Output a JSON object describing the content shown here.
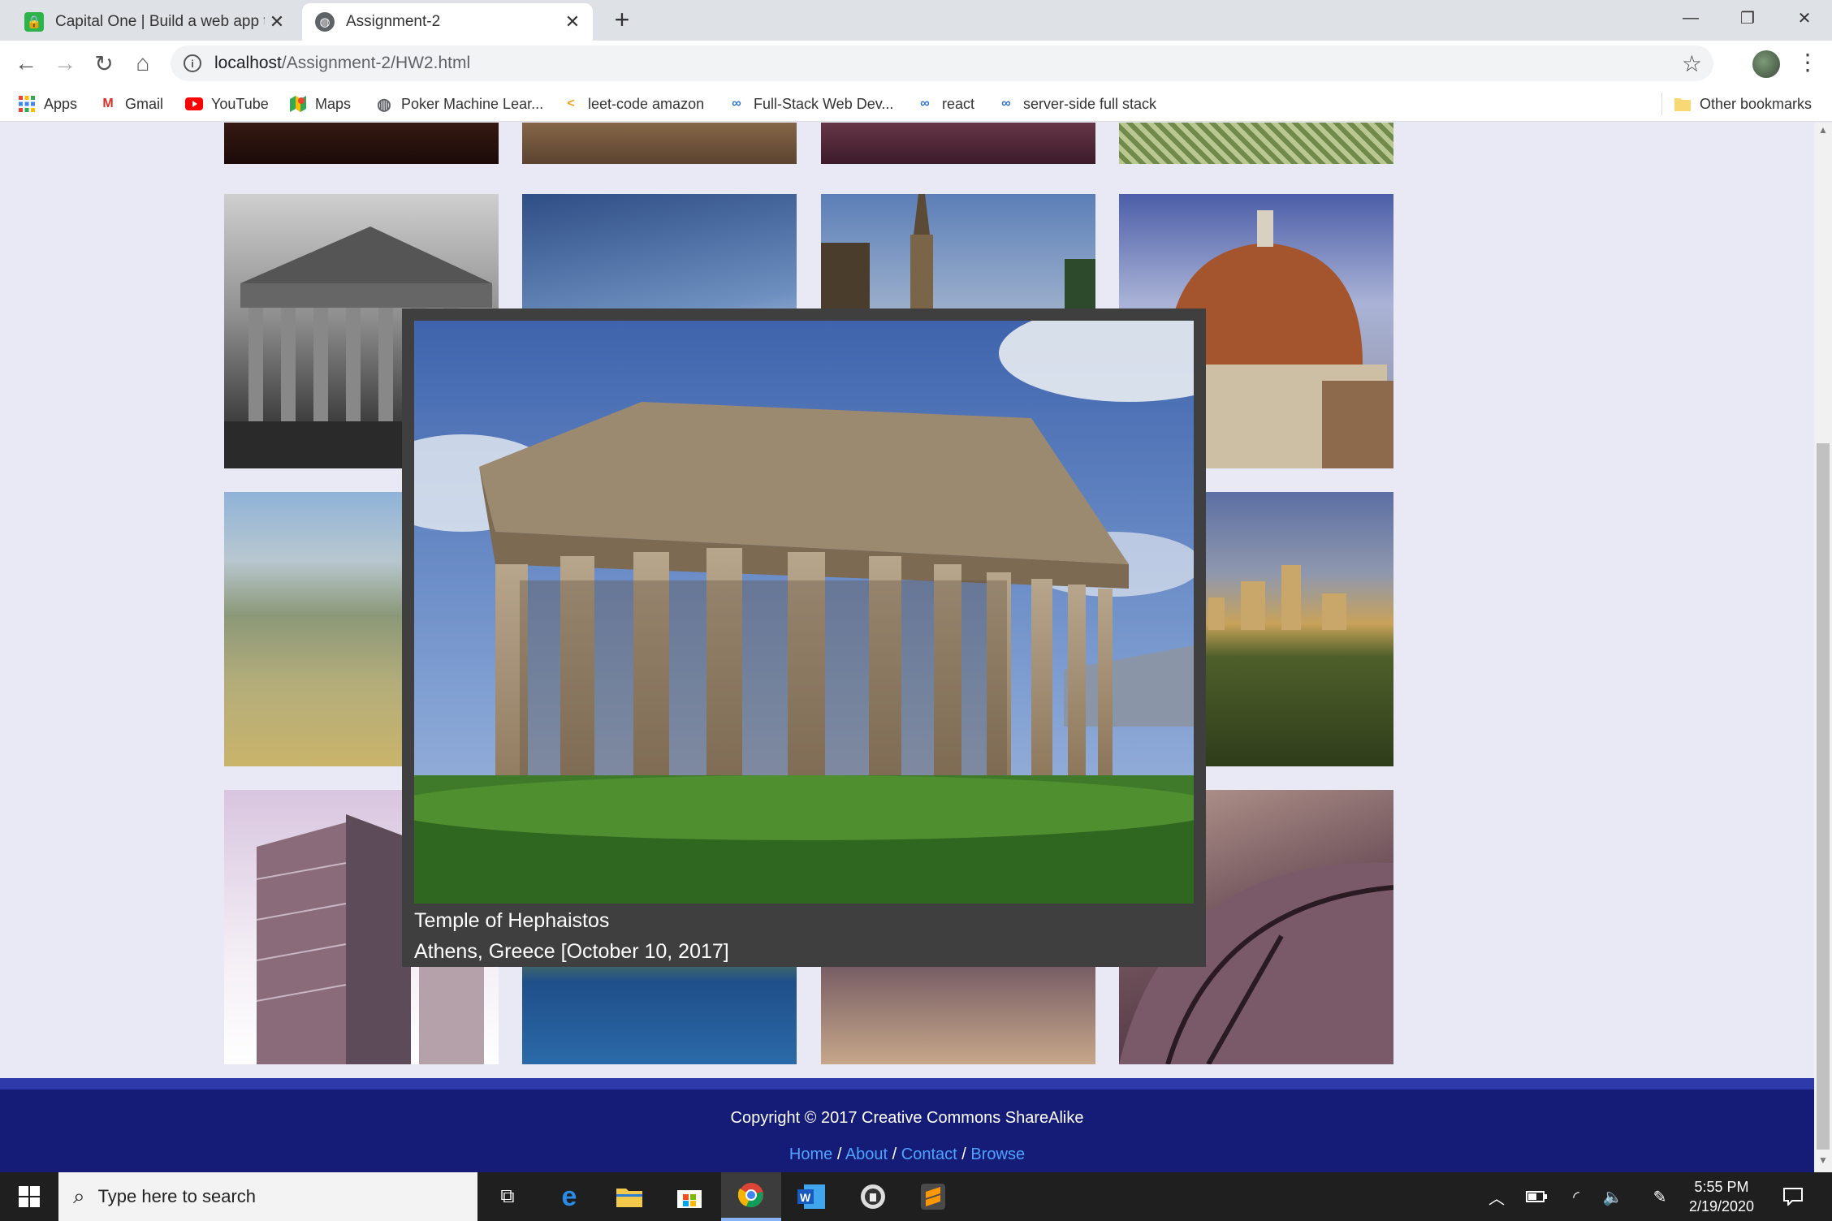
{
  "browser": {
    "tabs": [
      {
        "title": "Capital One | Build a web app to",
        "favicon": "lock-icon",
        "color": "#2db34a"
      },
      {
        "title": "Assignment-2",
        "favicon": "globe-icon",
        "color": "#5f6368"
      }
    ],
    "new_tab": "+",
    "window_controls": {
      "minimize": "—",
      "restore": "❐",
      "close": "✕"
    },
    "url_host": "localhost",
    "url_path": "/Assignment-2/HW2.html",
    "bookmarks": [
      {
        "label": "Apps",
        "icon": "apps-grid-icon"
      },
      {
        "label": "Gmail",
        "icon": "gmail-icon"
      },
      {
        "label": "YouTube",
        "icon": "youtube-icon"
      },
      {
        "label": "Maps",
        "icon": "maps-icon"
      },
      {
        "label": "Poker Machine Lear...",
        "icon": "globe-icon"
      },
      {
        "label": "leet-code amazon",
        "icon": "leetcode-icon"
      },
      {
        "label": "Full-Stack Web Dev...",
        "icon": "coursera-icon"
      },
      {
        "label": "react",
        "icon": "coursera-icon"
      },
      {
        "label": "server-side full stack",
        "icon": "coursera-icon"
      }
    ],
    "other_bookmarks": "Other bookmarks"
  },
  "gallery": {
    "lightbox": {
      "title": "Temple of Hephaistos",
      "subtitle": "Athens, Greece [October 10, 2017]"
    }
  },
  "footer": {
    "copyright": "Copyright © 2017 Creative Commons ShareAlike",
    "links": [
      "Home",
      "About",
      "Contact",
      "Browse"
    ],
    "separator": "/"
  },
  "taskbar": {
    "search_placeholder": "Type here to search",
    "time": "5:55 PM",
    "date": "2/19/2020"
  },
  "colors": {
    "footer_bg": "#151c77",
    "footer_band": "#2e3aaa",
    "link": "#4da3ff",
    "page_bg": "#e8e9f5"
  }
}
